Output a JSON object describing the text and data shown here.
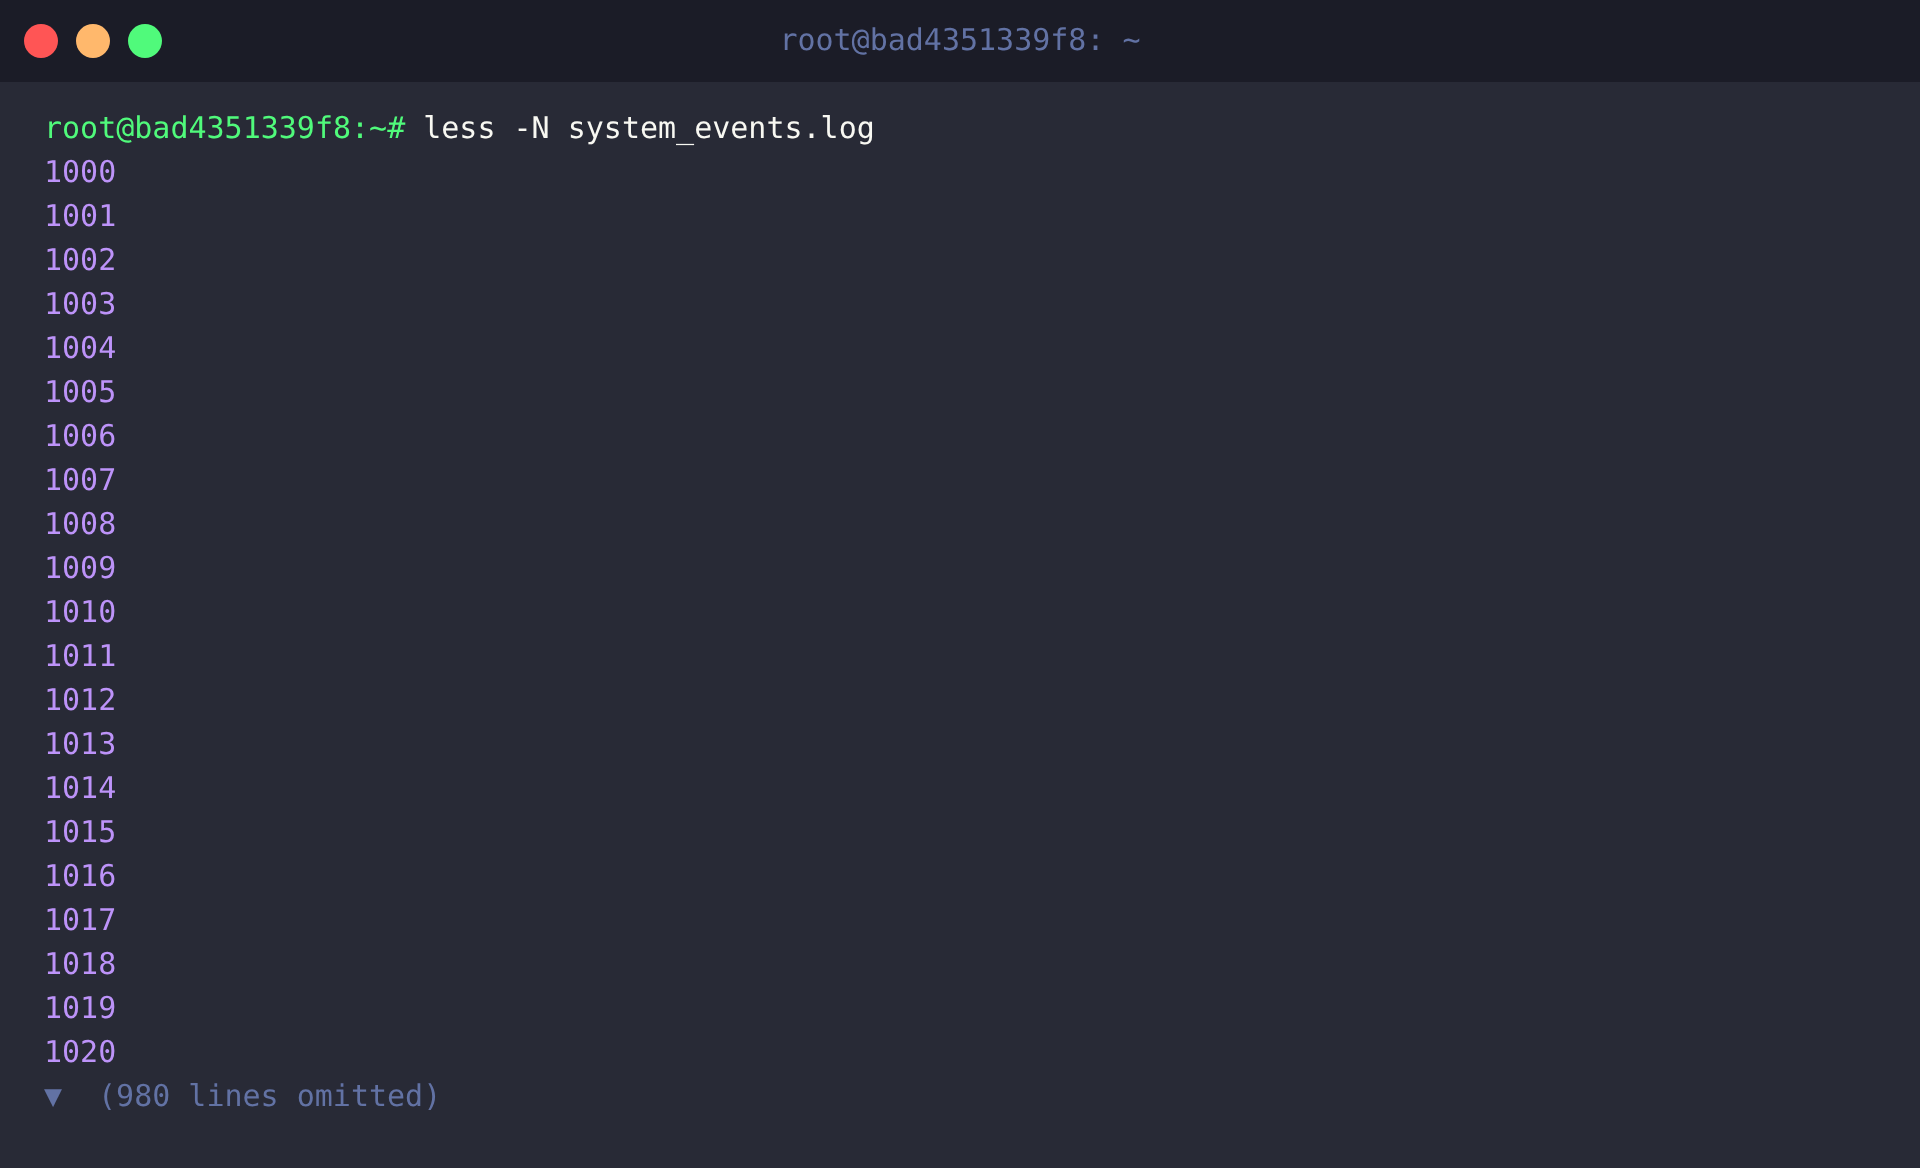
{
  "window": {
    "title": "root@bad4351339f8: ~"
  },
  "prompt": {
    "user_host": "root@bad4351339f8:~#",
    "command": "less -N system_events.log"
  },
  "line_numbers": [
    "1000",
    "1001",
    "1002",
    "1003",
    "1004",
    "1005",
    "1006",
    "1007",
    "1008",
    "1009",
    "1010",
    "1011",
    "1012",
    "1013",
    "1014",
    "1015",
    "1016",
    "1017",
    "1018",
    "1019",
    "1020"
  ],
  "omitted": {
    "marker": "▼",
    "text": "(980 lines omitted)"
  }
}
